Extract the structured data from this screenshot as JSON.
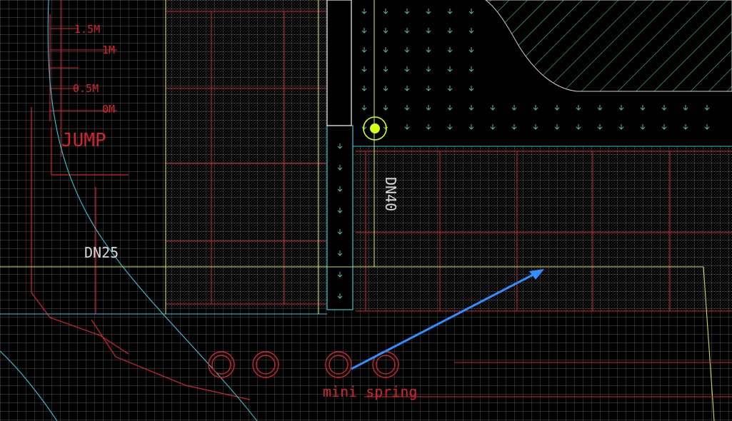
{
  "viewport": {
    "background": "#000000",
    "grid_color": "#6e6e6e",
    "paving_color": "#9a9a9a",
    "red_color": "#d0262c",
    "yellow_green_color": "#c8e04a",
    "cyan_color": "#36c6d8",
    "pointer_color": "#2f8fff",
    "marker_color": "#d6ff1a",
    "water_hatch_color": "#4fe39a"
  },
  "labels": {
    "pipe_dn25": "DN25",
    "pipe_dn40": "DN40",
    "scale_1_5m": "1.5M",
    "scale_1m": "1M",
    "scale_0_5m": "0.5M",
    "scale_0m": "0M",
    "jump_text": "JUMP",
    "fountain_text": "mini spring"
  },
  "icons": {
    "node_marker": "circle-node-icon",
    "pointer_arrow": "arrow-pointer-icon",
    "drain_marker": "drain-arrow-icon",
    "nozzle_marker": "nozzle-circle-icon"
  }
}
